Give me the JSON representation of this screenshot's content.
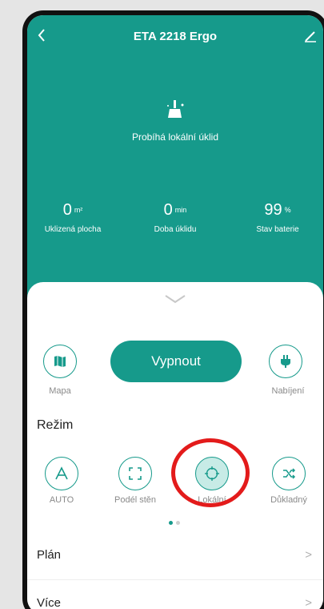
{
  "header": {
    "title": "ETA 2218 Ergo",
    "back_icon": "back-arrow-icon",
    "edit_icon": "edit-pencil-icon"
  },
  "status": {
    "icon": "broom-sparkle-icon",
    "text": "Probíhá lokální úklid"
  },
  "stats": [
    {
      "value": "0",
      "unit": "m²",
      "label": "Uklizená plocha"
    },
    {
      "value": "0",
      "unit": "min",
      "label": "Doba úklidu"
    },
    {
      "value": "99",
      "unit": "%",
      "label": "Stav baterie"
    }
  ],
  "controls": {
    "map_label": "Mapa",
    "main_button": "Vypnout",
    "charge_label": "Nabíjení"
  },
  "mode_section": {
    "title": "Režim",
    "modes": [
      {
        "label": "AUTO",
        "icon": "letter-a-icon"
      },
      {
        "label": "Podél stěn",
        "icon": "edge-frame-icon"
      },
      {
        "label": "Lokální",
        "icon": "spot-target-icon",
        "selected": true
      },
      {
        "label": "Důkladný",
        "icon": "shuffle-icon"
      }
    ]
  },
  "list": [
    {
      "label": "Plán",
      "arrow": ">"
    },
    {
      "label": "Více",
      "arrow": ">"
    }
  ],
  "colors": {
    "accent": "#169a8b",
    "highlight": "#e31b1b"
  }
}
